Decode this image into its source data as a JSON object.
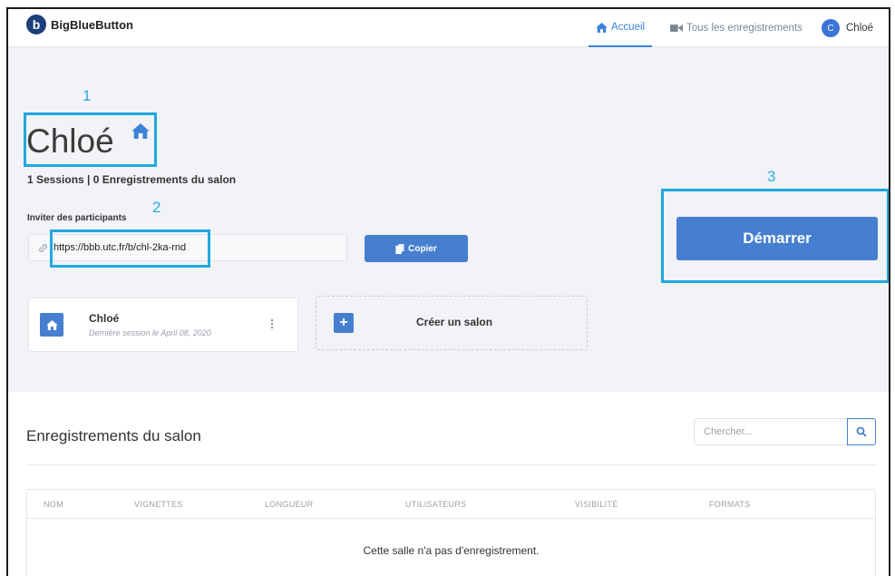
{
  "header": {
    "brand": "BigBlueButton",
    "brand_letter": "b",
    "nav_home": "Accueil",
    "nav_recordings": "Tous les enregistrements",
    "user_initial": "C",
    "user_name": "Chloé"
  },
  "room": {
    "title": "Chloé",
    "stats": "1 Sessions | 0 Enregistrements du salon",
    "invite_label": "Inviter des participants",
    "invite_url": "https://bbb.utc.fr/b/chl-2ka-rnd",
    "copy_label": "Copier",
    "start_label": "Démarrer"
  },
  "annotations": [
    "1",
    "2",
    "3"
  ],
  "cards": {
    "room_name": "Chloé",
    "room_last_session": "Dernière session le April 08, 2020",
    "create_label": "Créer un salon"
  },
  "recordings": {
    "title": "Enregistrements du salon",
    "search_placeholder": "Chercher...",
    "columns": [
      "NOM",
      "VIGNETTES",
      "LONGUEUR",
      "UTILISATEURS",
      "VISIBILITÉ",
      "FORMATS"
    ],
    "empty_message": "Cette salle n'a pas d'enregistrement."
  },
  "colors": {
    "primary": "#467fcf",
    "annotation": "#22a7e0",
    "hero_bg": "#f1f3f7"
  }
}
